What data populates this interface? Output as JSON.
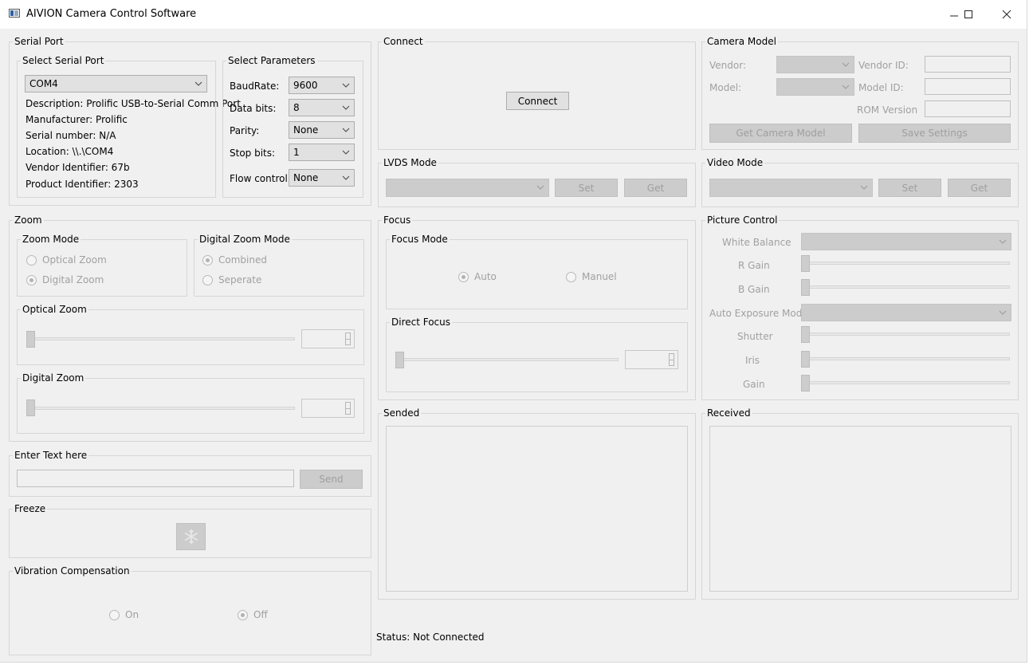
{
  "window": {
    "title": "AIVION Camera Control Software"
  },
  "serial": {
    "title": "Serial Port",
    "select_port_title": "Select Serial Port",
    "port": "COM4",
    "info": [
      "Description: Prolific USB-to-Serial Comm Port",
      "Manufacturer: Prolific",
      "Serial number: N/A",
      "Location: \\\\.\\COM4",
      "Vendor Identifier: 67b",
      "Product Identifier: 2303"
    ],
    "params_title": "Select Parameters",
    "params": [
      {
        "label": "BaudRate:",
        "value": "9600"
      },
      {
        "label": "Data bits:",
        "value": "8"
      },
      {
        "label": "Parity:",
        "value": "None"
      },
      {
        "label": "Stop bits:",
        "value": "1"
      },
      {
        "label": "Flow control:",
        "value": "None"
      }
    ]
  },
  "connect": {
    "title": "Connect",
    "button": "Connect"
  },
  "camera_model": {
    "title": "Camera Model",
    "vendor_label": "Vendor:",
    "model_label": "Model:",
    "vendor_id_label": "Vendor ID:",
    "model_id_label": "Model ID:",
    "rom_label": "ROM Version",
    "get_button": "Get Camera Model",
    "save_button": "Save Settings"
  },
  "lvds": {
    "title": "LVDS Mode",
    "set": "Set",
    "get": "Get"
  },
  "video": {
    "title": "Video Mode",
    "set": "Set",
    "get": "Get"
  },
  "zoom": {
    "title": "Zoom",
    "mode_title": "Zoom Mode",
    "optical": "Optical Zoom",
    "digital": "Digital Zoom",
    "digital_mode_title": "Digital Zoom Mode",
    "combined": "Combined",
    "separate": "Seperate",
    "optical_title": "Optical Zoom",
    "digital_title": "Digital Zoom"
  },
  "focus": {
    "title": "Focus",
    "mode_title": "Focus Mode",
    "auto": "Auto",
    "manual": "Manuel",
    "direct_title": "Direct Focus"
  },
  "picture": {
    "title": "Picture Control",
    "white_balance": "White Balance",
    "r_gain": "R Gain",
    "b_gain": "B Gain",
    "ae_mode": "Auto Exposure Mode",
    "shutter": "Shutter",
    "iris": "Iris",
    "gain": "Gain"
  },
  "text": {
    "title": "Enter Text here",
    "send": "Send"
  },
  "sended": {
    "title": "Sended"
  },
  "received": {
    "title": "Received"
  },
  "freeze": {
    "title": "Freeze"
  },
  "vibration": {
    "title": "Vibration Compensation",
    "on": "On",
    "off": "Off"
  },
  "status": {
    "text": "Status: Not Connected"
  }
}
